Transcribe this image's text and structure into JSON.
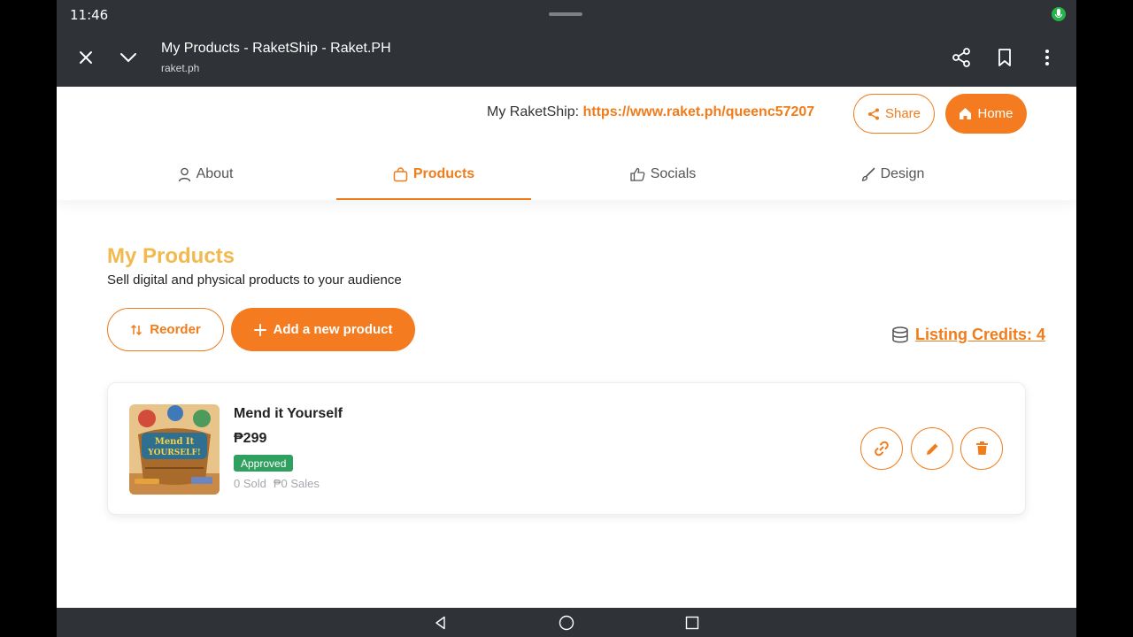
{
  "status": {
    "time": "11:46"
  },
  "browser": {
    "title": "My Products - RaketShip - Raket.PH",
    "url": "raket.ph"
  },
  "header": {
    "raketship_label": "My RaketShip:",
    "raketship_link": "https://www.raket.ph/queenc57207",
    "share_label": "Share",
    "home_label": "Home"
  },
  "tabs": [
    {
      "label": "About",
      "icon": "person-icon"
    },
    {
      "label": "Products",
      "icon": "bag-icon"
    },
    {
      "label": "Socials",
      "icon": "thumbs-up-icon"
    },
    {
      "label": "Design",
      "icon": "brush-icon"
    }
  ],
  "main": {
    "title": "My Products",
    "subtitle": "Sell digital and physical products to your audience",
    "reorder_label": "Reorder",
    "add_label": "Add a new product",
    "credits_label": "Listing Credits: 4"
  },
  "products": [
    {
      "name": "Mend it Yourself",
      "price": "₱299",
      "status": "Approved",
      "sold": "0 Sold",
      "sales": "₱0 Sales",
      "thumb_text": "Mend It YOURSELF!"
    }
  ],
  "colors": {
    "accent": "#f47b20",
    "title_yellow": "#f2b94f",
    "approved_green": "#2fa05f",
    "chrome_dark": "#2f3236"
  }
}
